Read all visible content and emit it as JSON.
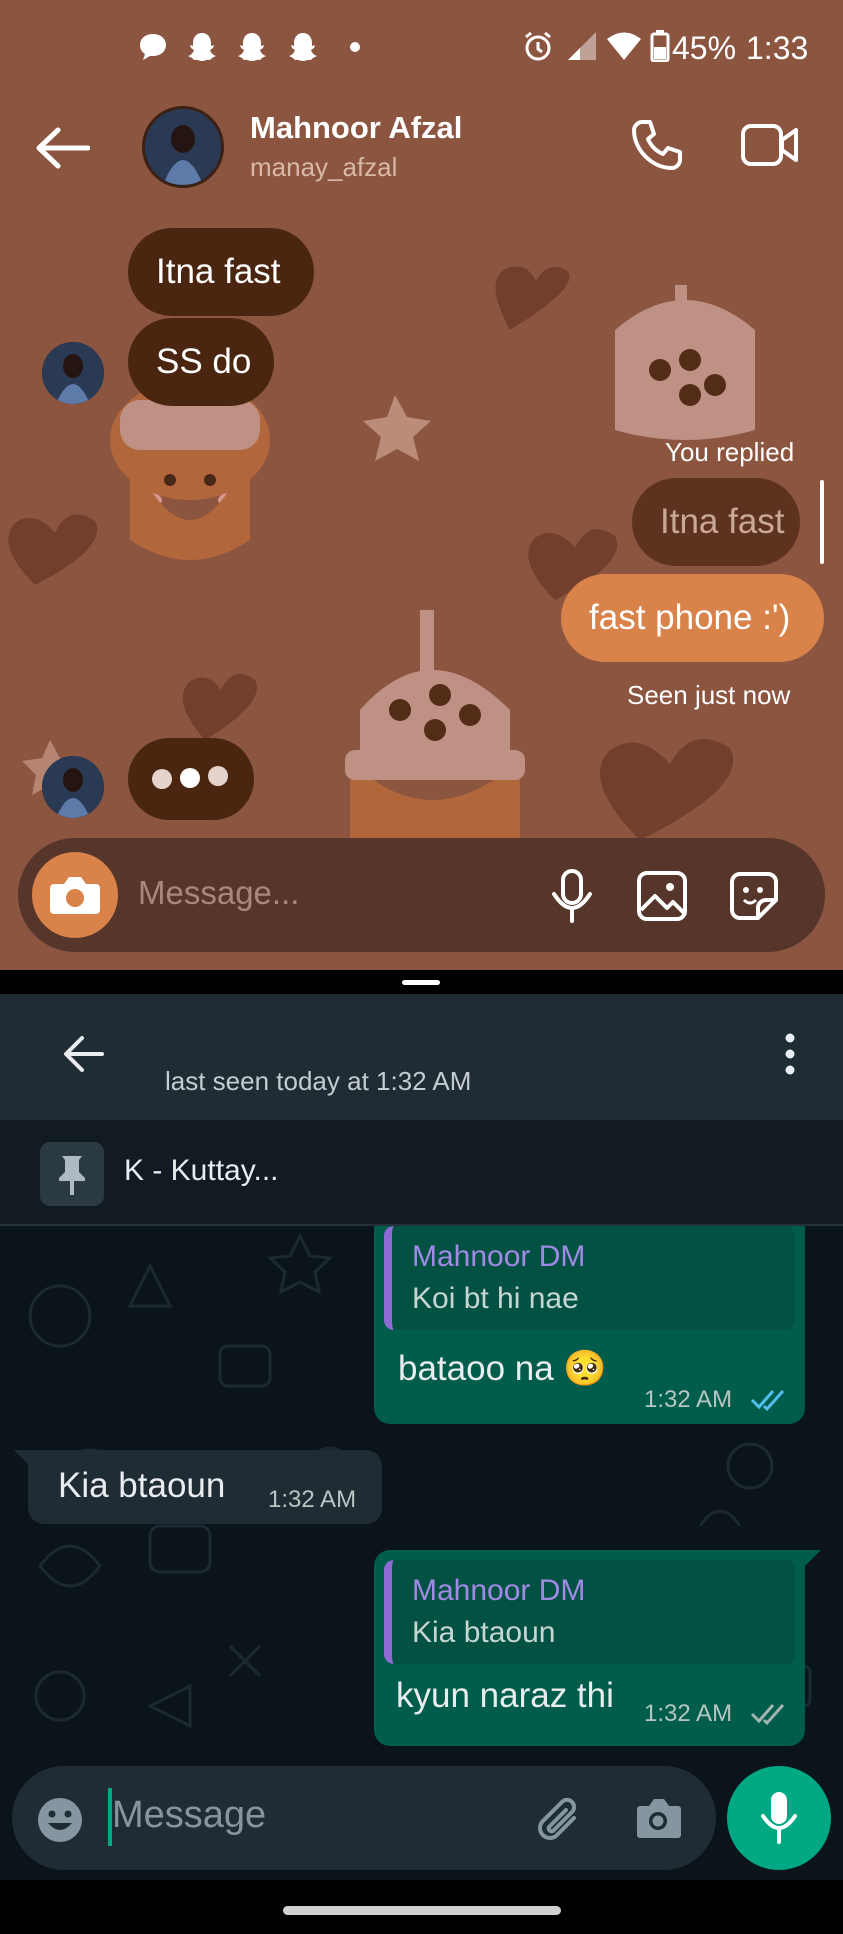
{
  "status_bar": {
    "battery": "45%",
    "time": "1:33",
    "icons": [
      "messages-icon",
      "snapchat-icon",
      "snapchat-icon",
      "snapchat-icon",
      "dot-icon",
      "alarm-icon",
      "signal-icon",
      "wifi-icon",
      "battery-icon"
    ]
  },
  "instagram": {
    "contact_name": "Mahnoor Afzal",
    "username": "manay_afzal",
    "messages": [
      {
        "text": "Itna fast"
      },
      {
        "text": "SS do"
      }
    ],
    "you_replied_label": "You replied",
    "replied_to_text": "Itna fast",
    "sent_message": "fast phone :')",
    "seen_label": "Seen just now",
    "composer_placeholder": "Message...",
    "colors": {
      "background": "#8b5540",
      "incoming": "#4a2610",
      "outgoing": "#d9824a"
    }
  },
  "whatsapp": {
    "last_seen": "last seen today at 1:32 AM",
    "pinned_text": "K - Kuttay...",
    "messages": [
      {
        "quote_name": "Mahnoor DM",
        "quote_text": "Koi bt hi nae",
        "text": "bataoo na 🥺",
        "time": "1:32 AM"
      },
      {
        "text": "Kia btaoun",
        "time": "1:32 AM"
      },
      {
        "quote_name": "Mahnoor DM",
        "quote_text": "Kia btaoun",
        "text": "kyun naraz thi",
        "time": "1:32 AM"
      }
    ],
    "composer_placeholder": "Message",
    "colors": {
      "accent": "#00a884",
      "outgoing": "#005c4b",
      "incoming": "#202c33"
    }
  }
}
